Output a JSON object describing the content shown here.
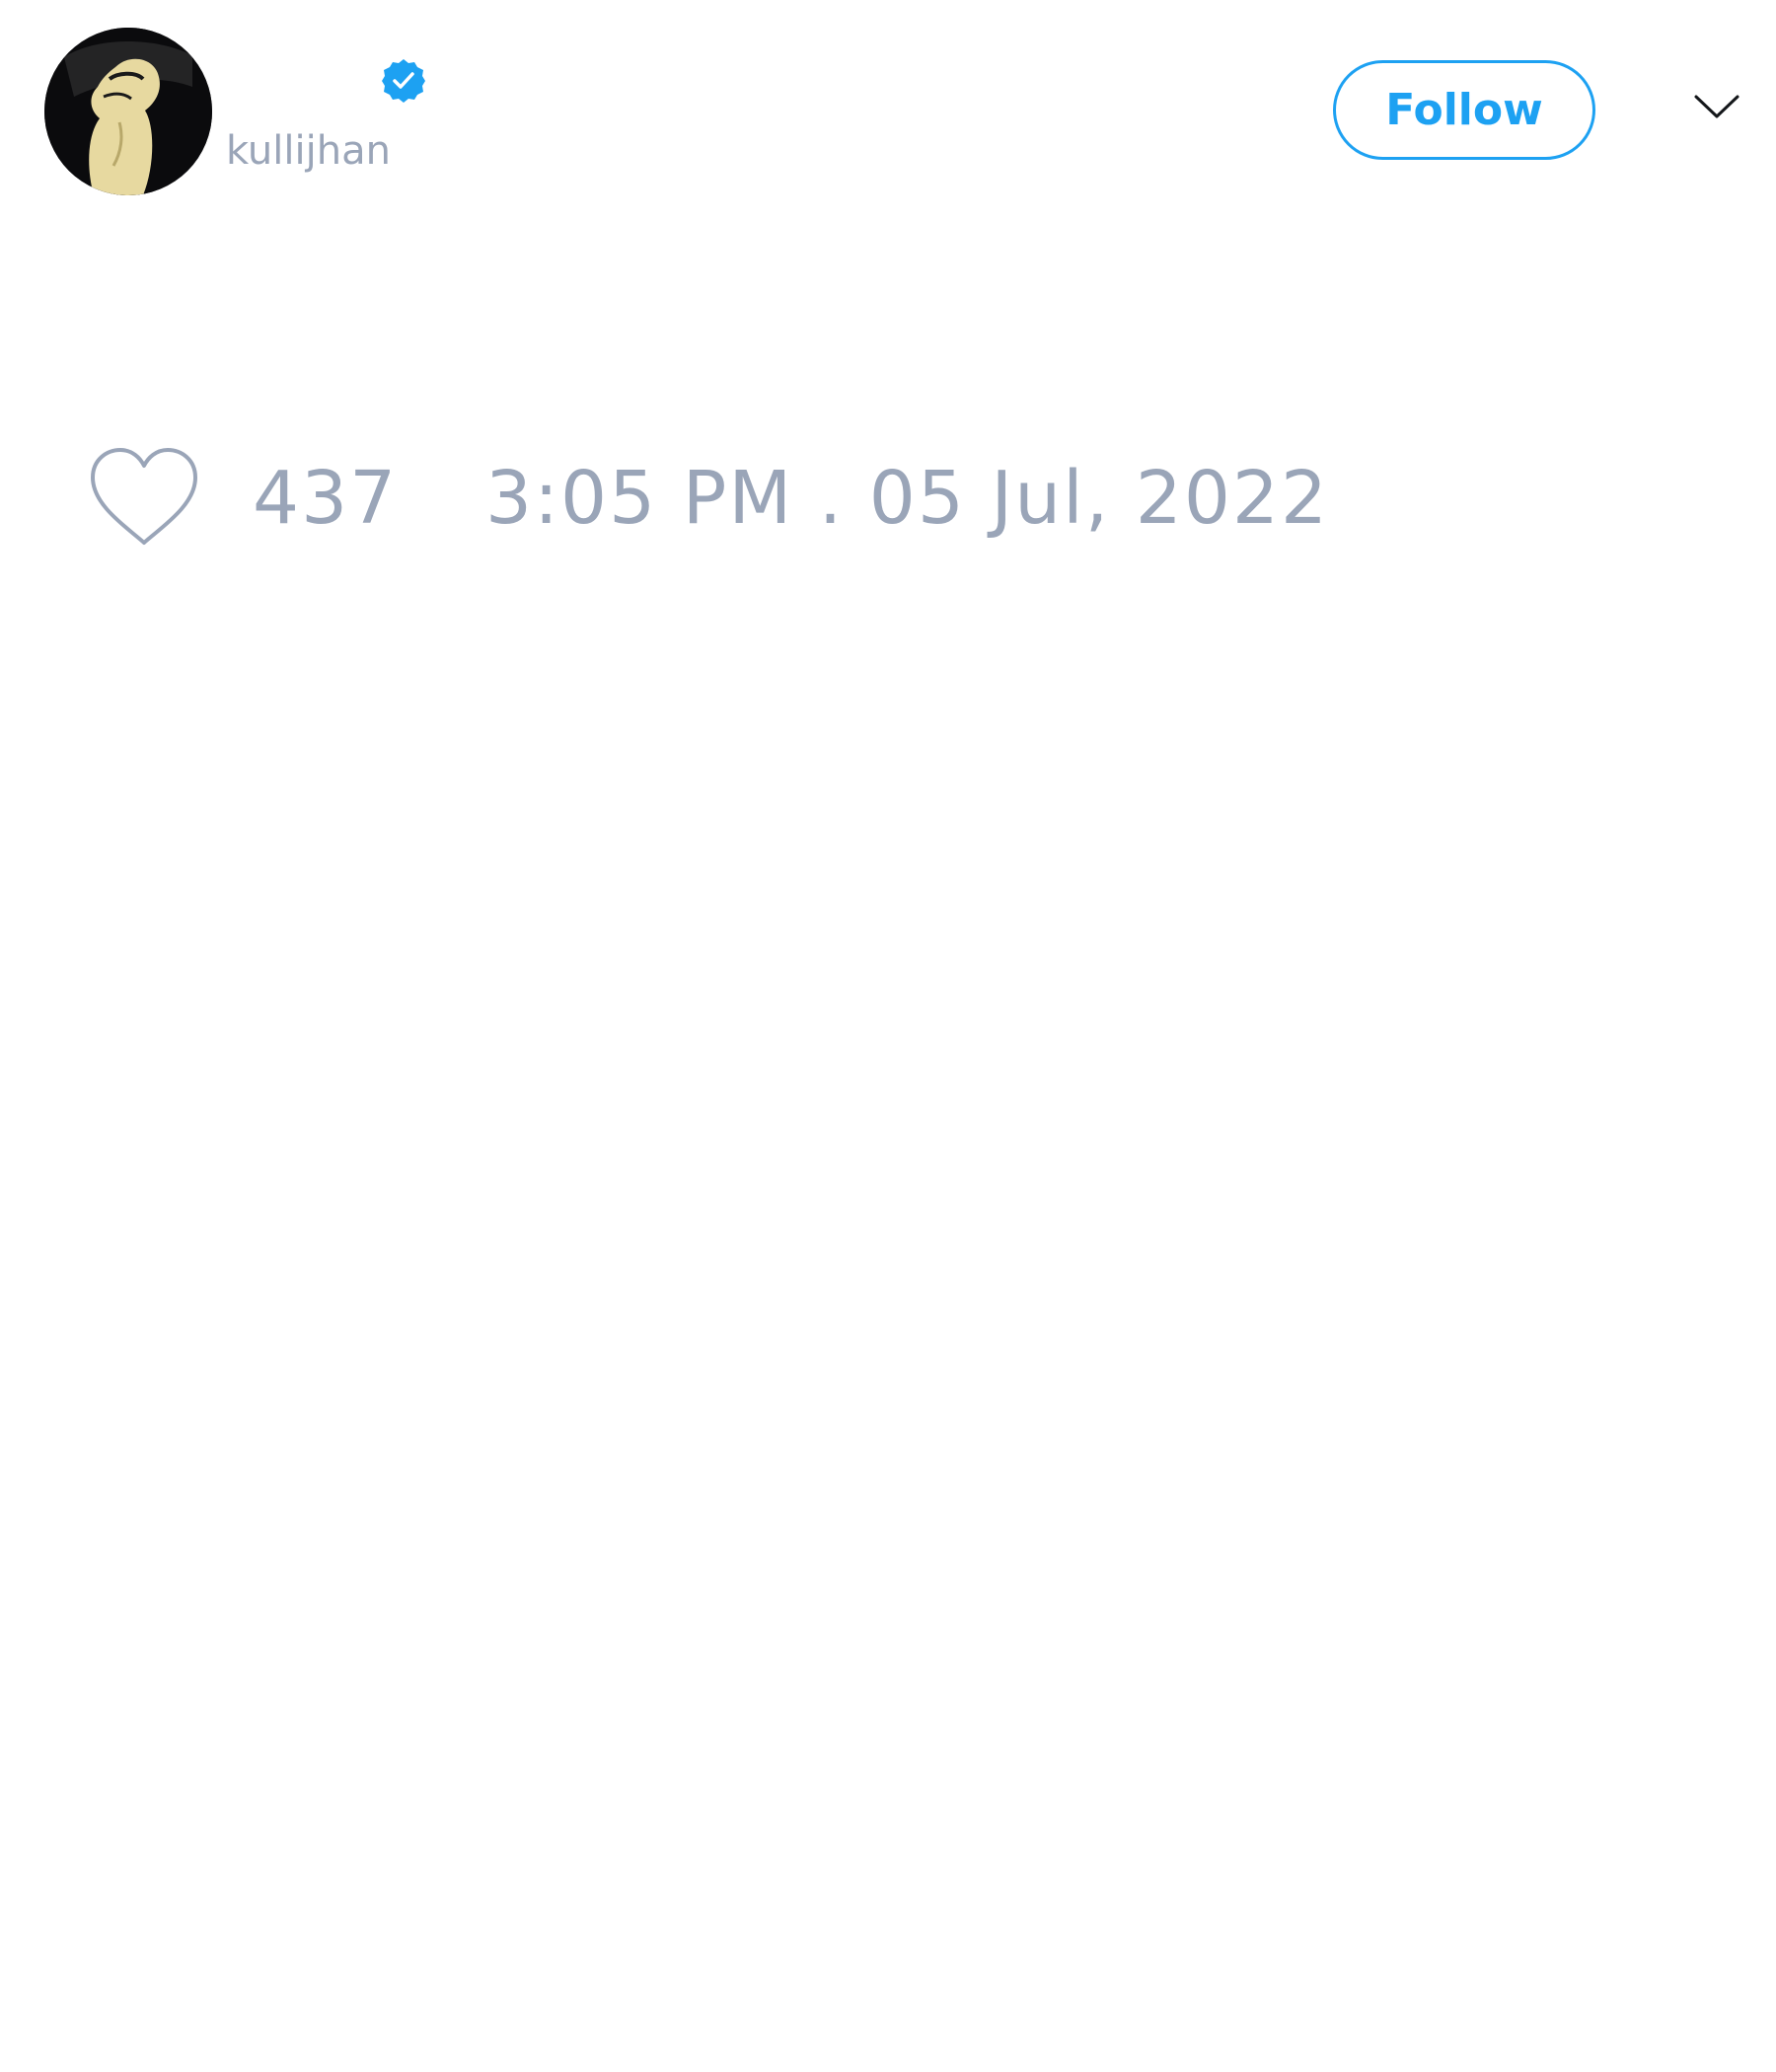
{
  "author": {
    "display_name": "",
    "username": "kullijhan",
    "verified": true,
    "avatar_icon": "avatar-image"
  },
  "actions": {
    "follow_label": "Follow",
    "menu_icon": "chevron-down-icon"
  },
  "footer": {
    "like_icon": "heart-outline-icon",
    "like_count": "437",
    "timestamp": "3:05 PM . 05 Jul, 2022"
  },
  "colors": {
    "accent": "#1da1f2",
    "muted_text": "#9aa5b8",
    "avatar_background": "#0b0b0d",
    "avatar_figure": "#e7d9a0"
  }
}
